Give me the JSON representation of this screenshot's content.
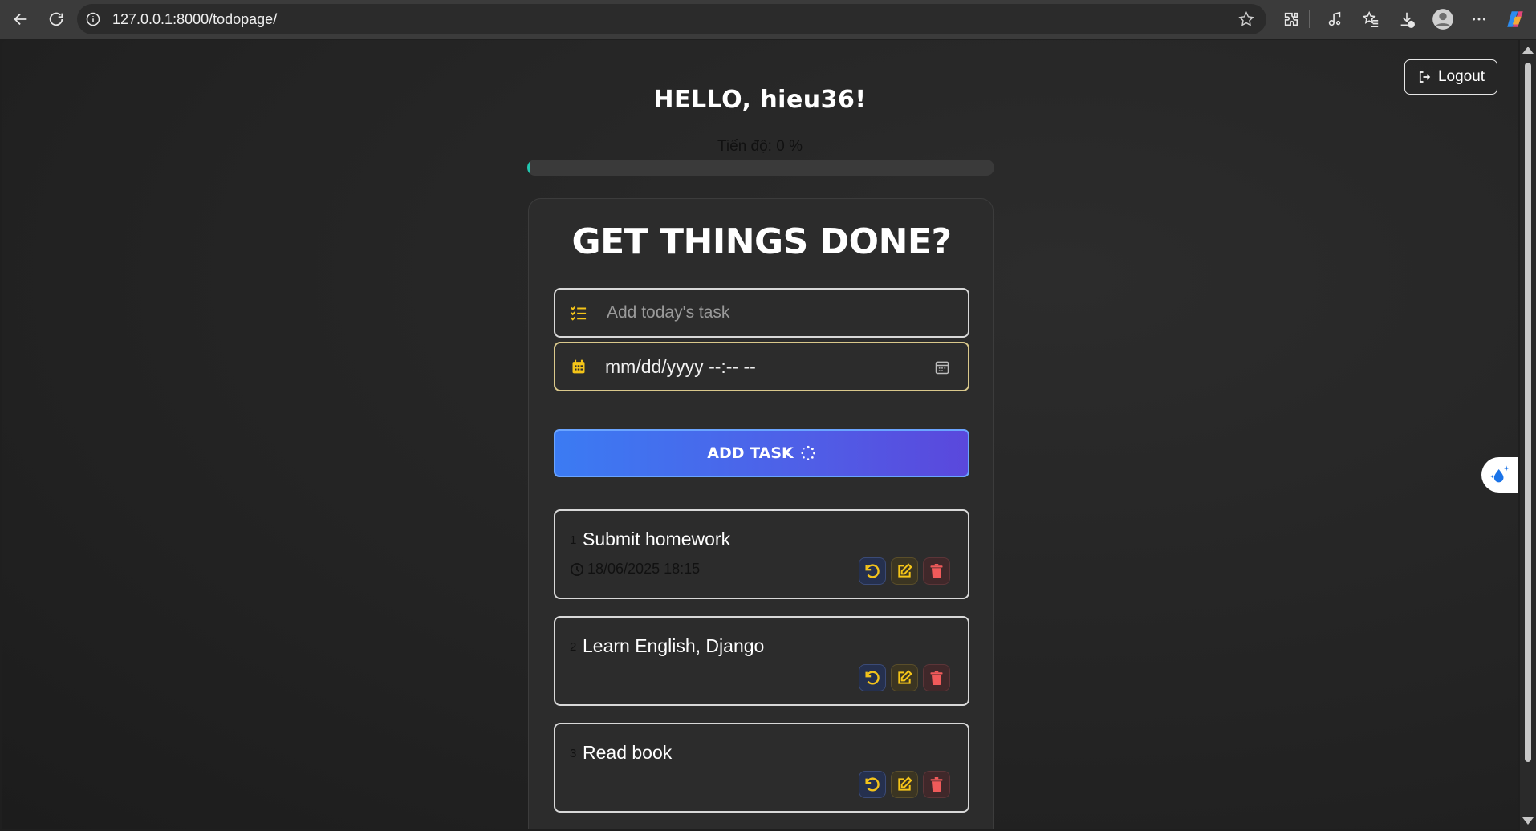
{
  "browser": {
    "url": "127.0.0.1:8000/todopage/",
    "icons": [
      "back-icon",
      "refresh-icon",
      "info-icon",
      "star-icon",
      "extensions-icon",
      "media-icon",
      "favorites-icon",
      "downloads-icon",
      "profile-icon",
      "more-icon",
      "copilot-icon"
    ]
  },
  "header": {
    "logout_label": "Logout",
    "greeting": "HELLO, hieu36!",
    "progress_label": "Tiến độ: 0 %",
    "progress_value": 0
  },
  "main": {
    "heading": "GET THINGS DONE?",
    "task_placeholder": "Add today's task",
    "date_value": "mm/dd/yyyy --:-- --",
    "add_button_label": "ADD TASK"
  },
  "tasks": [
    {
      "num": "1",
      "title": "Submit homework",
      "due": "18/06/2025 18:15"
    },
    {
      "num": "2",
      "title": "Learn English, Django",
      "due": ""
    },
    {
      "num": "3",
      "title": "Read book",
      "due": ""
    }
  ],
  "colors": {
    "accent_yellow": "#f5c518",
    "undo_yellow": "#f2c21b",
    "delete_red": "#f05a5a",
    "button_gradient": [
      "#3b7bf3",
      "#5a48dc"
    ],
    "progress_fill": "#20c7b0"
  }
}
